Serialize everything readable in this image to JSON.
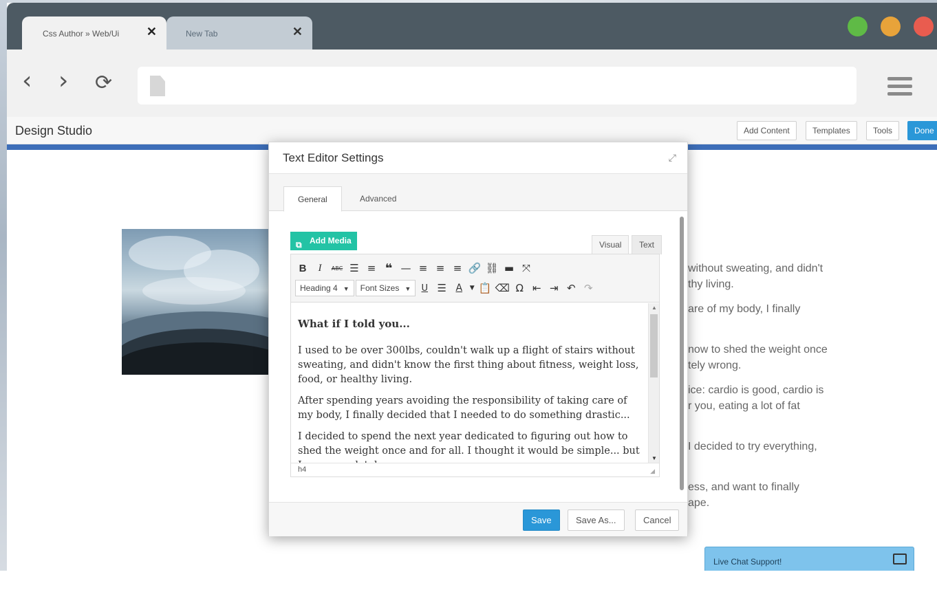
{
  "browser": {
    "tabs": [
      {
        "title": "Css Author » Web/Ui",
        "close": "✕"
      },
      {
        "title": "New Tab",
        "close": "✕"
      }
    ],
    "nav": {
      "back": "‹",
      "forward": "›",
      "reload": "⟳"
    }
  },
  "builder": {
    "title": "Design Studio",
    "buttons": {
      "add_content": "Add Content",
      "templates": "Templates",
      "tools": "Tools",
      "done": "Done"
    }
  },
  "background_text": [
    "without sweating, and didn't",
    "thy living.",
    "are of my body, I finally",
    "now to shed the weight once",
    "tely wrong.",
    "ice: cardio is good, cardio is",
    "r you, eating a lot of fat",
    "I decided to try everything,",
    "ess, and want to finally",
    "ape."
  ],
  "chat": {
    "label": "Live Chat Support!"
  },
  "modal": {
    "title": "Text Editor Settings",
    "expand_icon": "⤢",
    "tabs": {
      "general": "General",
      "advanced": "Advanced"
    },
    "editor": {
      "add_media": "Add Media",
      "mode_tabs": {
        "visual": "Visual",
        "text": "Text"
      },
      "format_select": "Heading 4",
      "font_size_select": "Font Sizes",
      "heading": "What if I told you...",
      "paragraphs": [
        "I used to be over 300lbs, couldn't walk up a flight of stairs without sweating, and didn't know the first thing about fitness, weight loss, food, or healthy living.",
        "After spending years avoiding the responsibility of taking care of my body, I finally decided that I needed to do something drastic...",
        "I decided to spend the next year dedicated to figuring out how to shed the weight once and for all. I thought it would be simple... but I was completely wrong."
      ],
      "status_path": "h4"
    },
    "footer": {
      "save": "Save",
      "save_as": "Save As...",
      "cancel": "Cancel"
    }
  },
  "colors": {
    "tabstrip": "#4d5a63",
    "accent_blue": "#2a97d8",
    "builder_bar_line": "#3d6eb8",
    "add_media_green": "#23c3a5",
    "traffic_green": "#5fba46",
    "traffic_yellow": "#e8a33a",
    "traffic_red": "#e95c4f"
  }
}
